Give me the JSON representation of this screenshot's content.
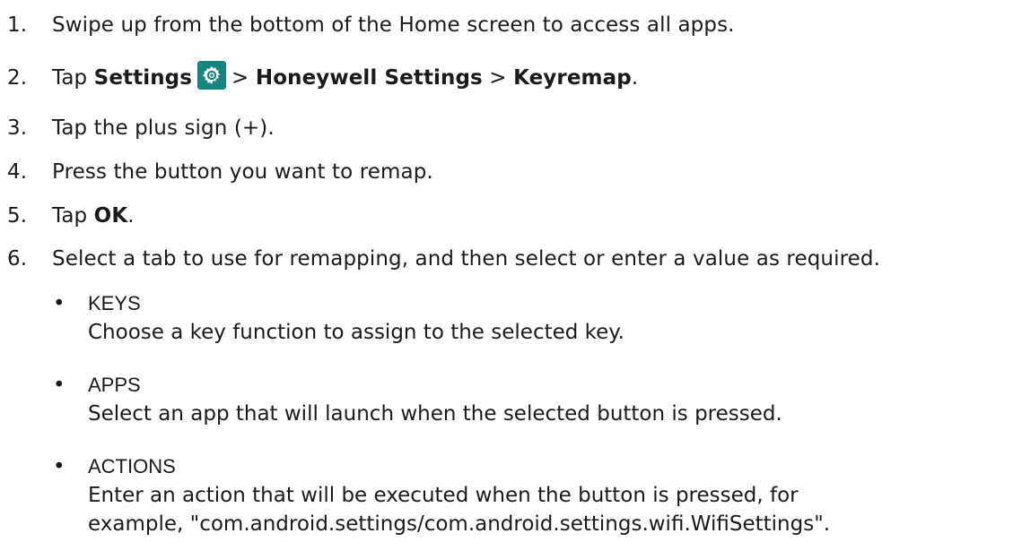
{
  "steps": [
    {
      "num": "1.",
      "text": "Swipe up from the bottom of the Home screen to access all apps."
    },
    {
      "num": "2.",
      "pre": "Tap",
      "settings": "Settings",
      "icon": "gear-icon",
      "sep1": ">",
      "honeywell": "Honeywell Settings",
      "sep2": ">",
      "keyremap": "Keyremap",
      "end": "."
    },
    {
      "num": "3.",
      "text": "Tap the plus sign (+)."
    },
    {
      "num": "4.",
      "text": "Press the button you want to remap."
    },
    {
      "num": "5.",
      "pre": "Tap",
      "ok": "OK",
      "end": "."
    },
    {
      "num": "6.",
      "text": "Select a tab to use for remapping, and then select or enter a value as required."
    }
  ],
  "bullets": [
    {
      "symbol": "•",
      "title": "KEYS",
      "desc": [
        "Choose a key function to assign to the selected key."
      ]
    },
    {
      "symbol": "•",
      "title": "APPS",
      "desc": [
        "Select an app that will launch when the selected button is pressed."
      ]
    },
    {
      "symbol": "•",
      "title": "ACTIONS",
      "desc": [
        "Enter an action that will be executed when the button is pressed, for",
        "example, \"com.android.settings/com.android.settings.wifi.WifiSettings\"."
      ]
    }
  ],
  "colors": {
    "icon_bg": "#15857e",
    "text": "#1a1a1a"
  }
}
